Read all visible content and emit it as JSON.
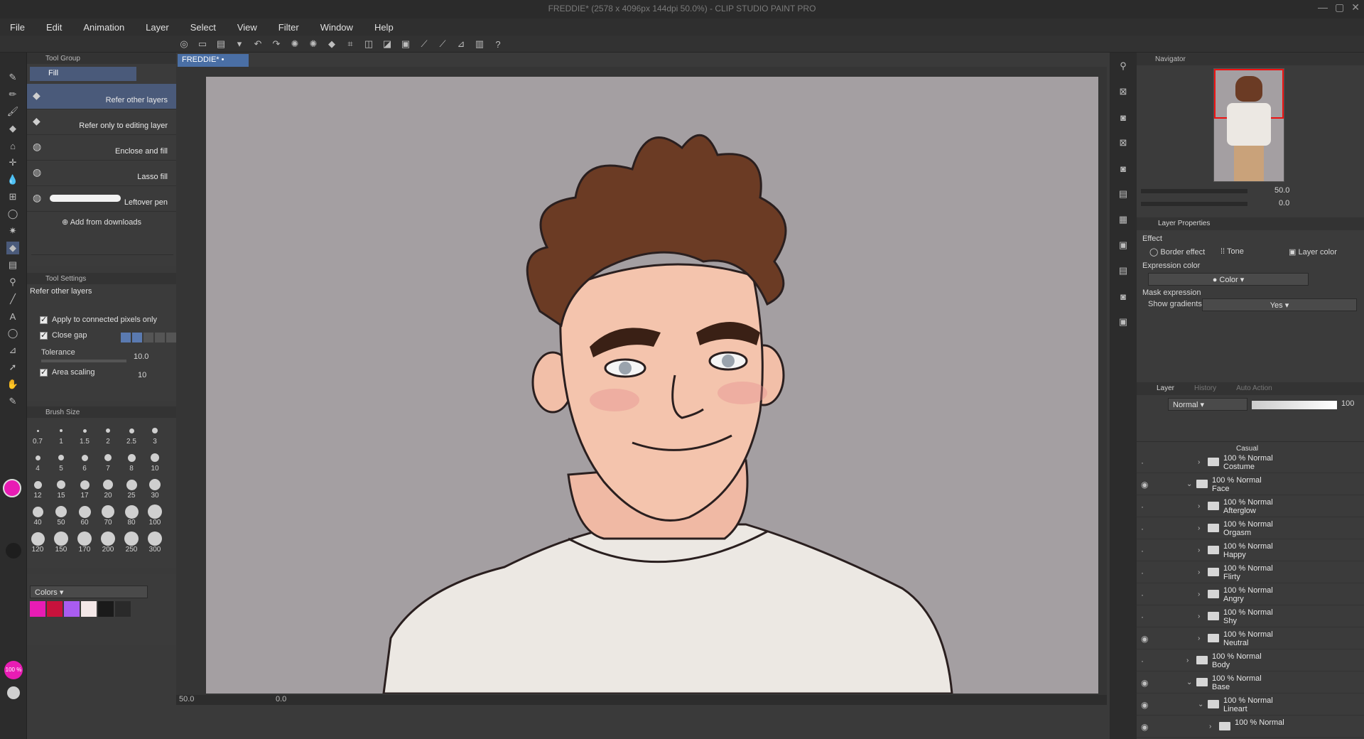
{
  "window": {
    "title": "FREDDIE* (2578 x 4096px 144dpi 50.0%) - CLIP STUDIO PAINT PRO"
  },
  "menu": [
    "File",
    "Edit",
    "Animation",
    "Layer",
    "Select",
    "View",
    "Filter",
    "Window",
    "Help"
  ],
  "document_tab": "FREDDIE*",
  "tool_group": {
    "title": "Tool Group",
    "active_tool": "Fill",
    "subtools": [
      {
        "label": "Refer other layers",
        "selected": true
      },
      {
        "label": "Refer only to editing layer",
        "selected": false
      },
      {
        "label": "Enclose and fill",
        "selected": false
      },
      {
        "label": "Lasso fill",
        "selected": false
      },
      {
        "label": "Leftover pen",
        "selected": false
      }
    ],
    "add_from_downloads": "Add from downloads"
  },
  "tool_settings": {
    "title": "Tool Settings",
    "subtool_name": "Refer other layers",
    "apply_connected": "Apply to connected pixels only",
    "close_gap": "Close gap",
    "tolerance_label": "Tolerance",
    "tolerance_value": "10.0",
    "area_scaling_label": "Area scaling",
    "area_scaling_value": "10"
  },
  "brush_size": {
    "title": "Brush Size",
    "sizes": [
      "0.7",
      "1",
      "1.5",
      "2",
      "2.5",
      "3",
      "4",
      "5",
      "6",
      "7",
      "8",
      "10",
      "12",
      "15",
      "17",
      "20",
      "25",
      "30",
      "40",
      "50",
      "60",
      "70",
      "80",
      "100",
      "120",
      "150",
      "170",
      "200",
      "250",
      "300"
    ]
  },
  "colors": {
    "dropdown": "Colors",
    "swatches": [
      "#e81cb4",
      "#c8123c",
      "#a95cf0",
      "#f4e8e8",
      "#1a1a1a",
      "#2a2a2a"
    ],
    "main_color": "#e81cb4",
    "opacity_badge": "100 %"
  },
  "canvas": {
    "zoom": "50.0",
    "rotation": "0.0",
    "background": "#a49fa2"
  },
  "navigator": {
    "title": "Navigator",
    "zoom": "50.0",
    "angle": "0.0"
  },
  "layer_properties": {
    "title": "Layer Properties",
    "effect_label": "Effect",
    "border_effect": "Border effect",
    "tone": "Tone",
    "layer_color": "Layer color",
    "expression_color_label": "Expression color",
    "expression_color_value": "Color",
    "mask_expression_label": "Mask expression",
    "show_gradients_label": "Show gradients",
    "show_gradients_value": "Yes"
  },
  "layer_panel": {
    "tabs": [
      "Layer",
      "History",
      "Auto Action"
    ],
    "blend_mode": "Normal",
    "opacity": "100",
    "cut_off_top": "Casual",
    "layers": [
      {
        "opacity": "100 % Normal",
        "name": "Costume",
        "indent": 1,
        "expanded": false,
        "visible": false
      },
      {
        "opacity": "100 % Normal",
        "name": "Face",
        "indent": 0,
        "expanded": true,
        "visible": true
      },
      {
        "opacity": "100 % Normal",
        "name": "Afterglow",
        "indent": 1,
        "expanded": false,
        "visible": false
      },
      {
        "opacity": "100 % Normal",
        "name": "Orgasm",
        "indent": 1,
        "expanded": false,
        "visible": false
      },
      {
        "opacity": "100 % Normal",
        "name": "Happy",
        "indent": 1,
        "expanded": false,
        "visible": false
      },
      {
        "opacity": "100 % Normal",
        "name": "Flirty",
        "indent": 1,
        "expanded": false,
        "visible": false
      },
      {
        "opacity": "100 % Normal",
        "name": "Angry",
        "indent": 1,
        "expanded": false,
        "visible": false
      },
      {
        "opacity": "100 % Normal",
        "name": "Shy",
        "indent": 1,
        "expanded": false,
        "visible": false
      },
      {
        "opacity": "100 % Normal",
        "name": "Neutral",
        "indent": 1,
        "expanded": false,
        "visible": true
      },
      {
        "opacity": "100 % Normal",
        "name": "Body",
        "indent": 0,
        "expanded": false,
        "visible": false
      },
      {
        "opacity": "100 % Normal",
        "name": "Base",
        "indent": 0,
        "expanded": true,
        "visible": true
      },
      {
        "opacity": "100 % Normal",
        "name": "Lineart",
        "indent": 1,
        "expanded": true,
        "visible": true
      },
      {
        "opacity": "100 % Normal",
        "name": "",
        "indent": 2,
        "expanded": false,
        "visible": true
      }
    ]
  }
}
